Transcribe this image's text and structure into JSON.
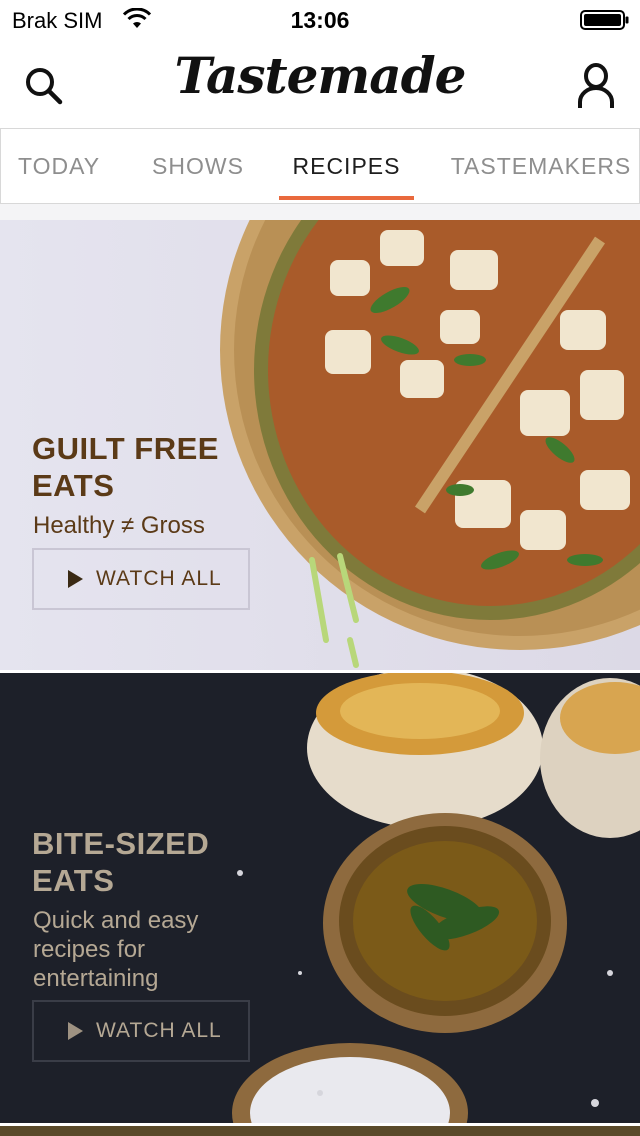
{
  "status_bar": {
    "carrier": "Brak SIM",
    "time": "13:06"
  },
  "nav": {
    "logo": "Tastemade"
  },
  "tabs": [
    {
      "label": "TODAY",
      "active": false
    },
    {
      "label": "SHOWS",
      "active": false
    },
    {
      "label": "RECIPES",
      "active": true
    },
    {
      "label": "TASTEMAKERS",
      "active": false
    }
  ],
  "colors": {
    "accent": "#e9693d",
    "card1_text": "#5b3a17",
    "card2_text": "#b5a894"
  },
  "cards": [
    {
      "title_line1": "GUILT FREE",
      "title_line2": "EATS",
      "subtitle": "Healthy ≠ Gross",
      "button": "WATCH ALL",
      "image": "zucchini-crust-pizza"
    },
    {
      "title_line1": "BITE-SIZED",
      "title_line2": "EATS",
      "subtitle": "Quick and easy recipes for entertaining",
      "button": "WATCH ALL",
      "image": "biscuits-and-herb-oil"
    }
  ]
}
